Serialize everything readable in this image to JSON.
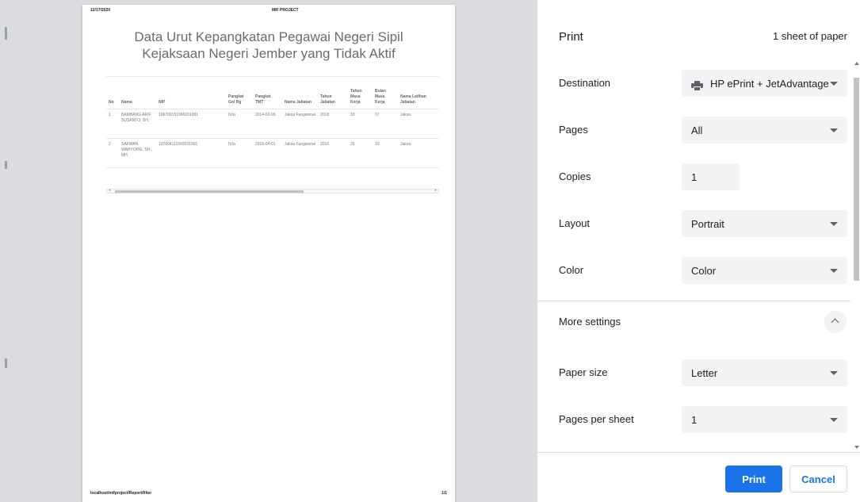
{
  "preview": {
    "header_date": "12/17/2020",
    "header_project": "MIF PROJECT",
    "title_line1": "Data Urut Kepangkatan Pegawai Negeri Sipil",
    "title_line2": "Kejaksaan Negeri Jember yang Tidak Aktif",
    "table": {
      "headers": [
        "No",
        "Nama",
        "NIP",
        "Pangkat Gol Rg",
        "Pangkat TMT",
        "Nama Jabatan",
        "Tahun Jabatan",
        "Tahun Masa Kerja",
        "Bulan Masa Kerja",
        "Nama Latihan Jabatan"
      ],
      "rows": [
        [
          "1",
          "BAMBANG ARIF SUSANTO, SH.",
          "196709151996031001",
          "IV/a",
          "2014-02-03",
          "Jaksa Fungsional",
          "2018",
          "33",
          "07",
          "Jaksa"
        ],
        [
          "2",
          "SAFWAN WAHYOPIE, SH., MH.",
          "197004111993031001",
          "IV/a",
          "2016-04-01",
          "Jaksa Fungsional",
          "2016",
          "26",
          "10",
          "Jaksa"
        ]
      ]
    },
    "footer_url": "localhost/mifproject/Report/filter",
    "footer_page": "1/1"
  },
  "panel": {
    "title": "Print",
    "sheet_count": "1 sheet of paper",
    "destination": {
      "label": "Destination",
      "value": "HP ePrint + JetAdvantage",
      "icon": "printer-icon"
    },
    "pages": {
      "label": "Pages",
      "value": "All"
    },
    "copies": {
      "label": "Copies",
      "value": "1"
    },
    "layout": {
      "label": "Layout",
      "value": "Portrait"
    },
    "color": {
      "label": "Color",
      "value": "Color"
    },
    "more_settings": {
      "label": "More settings",
      "icon": "chevron-up-icon"
    },
    "paper_size": {
      "label": "Paper size",
      "value": "Letter"
    },
    "pages_per_sheet": {
      "label": "Pages per sheet",
      "value": "1"
    },
    "print_label": "Print",
    "cancel_label": "Cancel"
  },
  "colors": {
    "accent": "#1a73e8",
    "preview_bg": "#dadce0",
    "field_bg": "#f1f3f4"
  }
}
